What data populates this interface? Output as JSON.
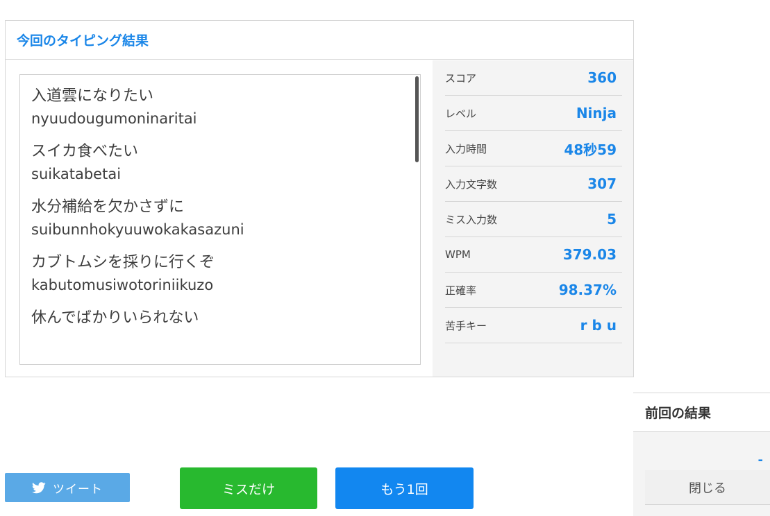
{
  "result": {
    "title": "今回のタイピング結果",
    "words": [
      {
        "jp": "入道雲になりたい",
        "romaji": "nyuudougumoninaritai"
      },
      {
        "jp": "スイカ食べたい",
        "romaji": "suikatabetai"
      },
      {
        "jp": "水分補給を欠かさずに",
        "romaji": "suibunnhokyuuwokakasazuni"
      },
      {
        "jp": "カブトムシを採りに行くぞ",
        "romaji": "kabutomusiwotoriniikuzo"
      },
      {
        "jp": "休んでばかりいられない",
        "romaji": ""
      }
    ],
    "stats": [
      {
        "label": "スコア",
        "value": "360"
      },
      {
        "label": "レベル",
        "value": "Ninja"
      },
      {
        "label": "入力時間",
        "value": "48秒59"
      },
      {
        "label": "入力文字数",
        "value": "307"
      },
      {
        "label": "ミス入力数",
        "value": "5"
      },
      {
        "label": "WPM",
        "value": "379.03"
      },
      {
        "label": "正確率",
        "value": "98.37%"
      },
      {
        "label": "苦手キー",
        "value": "r b u"
      }
    ]
  },
  "actions": {
    "tweet_label": "ツイート",
    "miss_only_label": "ミスだけ",
    "retry_label": "もう1回"
  },
  "previous": {
    "title": "前回の結果",
    "value": "-",
    "close_label": "閉じる"
  },
  "colors": {
    "accent": "#1a86e8",
    "tweet": "#5aa9e6",
    "miss_only": "#28b92f",
    "retry": "#1287f0"
  }
}
